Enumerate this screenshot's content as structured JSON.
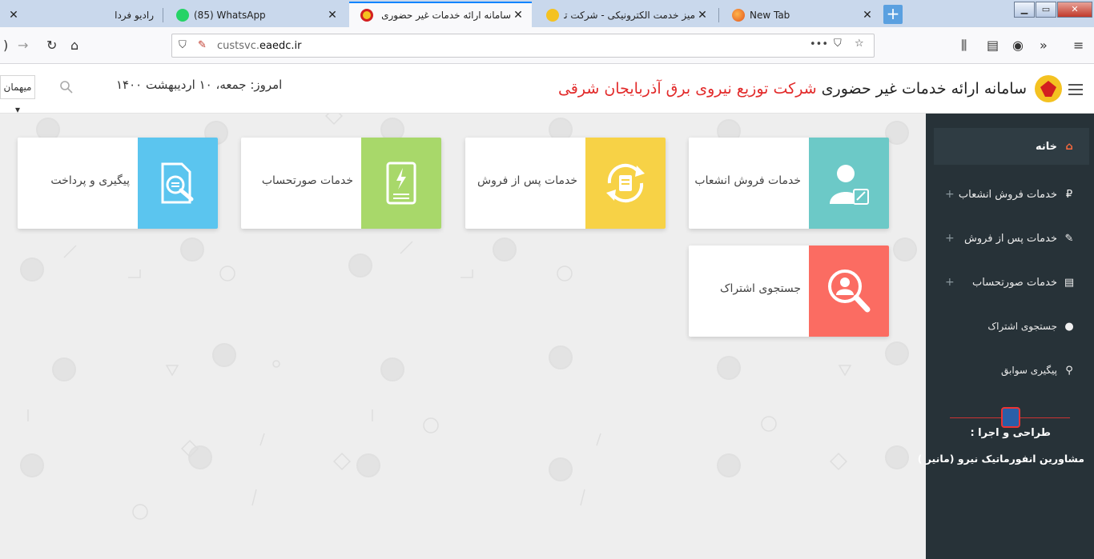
{
  "browser": {
    "tabs": [
      {
        "title": "رادیو فردا",
        "active": false
      },
      {
        "title": "(85) WhatsApp",
        "active": false
      },
      {
        "title": "سامانه ارائه خدمات غیر حضوری",
        "active": true
      },
      {
        "title": "میز خدمت الکترونیکی - شرکت توزیع",
        "active": false
      },
      {
        "title": "New Tab",
        "active": false
      }
    ],
    "url_prefix": "custsvc.",
    "url_domain": "eaedc.ir"
  },
  "header": {
    "title_main": "سامانه ارائه خدمات غیر حضوری",
    "title_accent": "شرکت توزیع نیروی برق آذربایجان شرقی",
    "date_text": "امروز: جمعه، ۱۰ اردیبهشت ۱۴۰۰",
    "user_label": "میهمان"
  },
  "cards": [
    {
      "label": "خدمات فروش انشعاب",
      "color": "#6cc9c7",
      "icon": "user-document-icon"
    },
    {
      "label": "خدمات پس از فروش",
      "color": "#f7d246",
      "icon": "after-sales-cycle-icon"
    },
    {
      "label": "خدمات صورتحساب",
      "color": "#a8d86a",
      "icon": "bill-icon"
    },
    {
      "label": "پیگیری و پرداخت",
      "color": "#5bc5ef",
      "icon": "search-document-icon"
    },
    {
      "label": "جستجوی اشتراک",
      "color": "#fb6c62",
      "icon": "search-user-icon"
    }
  ],
  "sidebar": {
    "items": [
      {
        "label": "خانه",
        "icon": "home-icon"
      },
      {
        "label": "خدمات فروش انشعاب",
        "icon": "plug-icon"
      },
      {
        "label": "خدمات پس از فروش",
        "icon": "edit-icon"
      },
      {
        "label": "خدمات صورتحساب",
        "icon": "list-icon"
      },
      {
        "label": "جستجوی اشتراک",
        "icon": "user-icon"
      },
      {
        "label": "پیگیری سوابق",
        "icon": "search-icon"
      }
    ],
    "credit_title": "طراحی و اجرا :",
    "credit_name": "مشاورین انفورماتیک نیرو (مانیر )"
  },
  "colors": {
    "accent": "#e22a2a",
    "sidebar_bg": "#273238",
    "home_icon": "#ff6a3d"
  }
}
